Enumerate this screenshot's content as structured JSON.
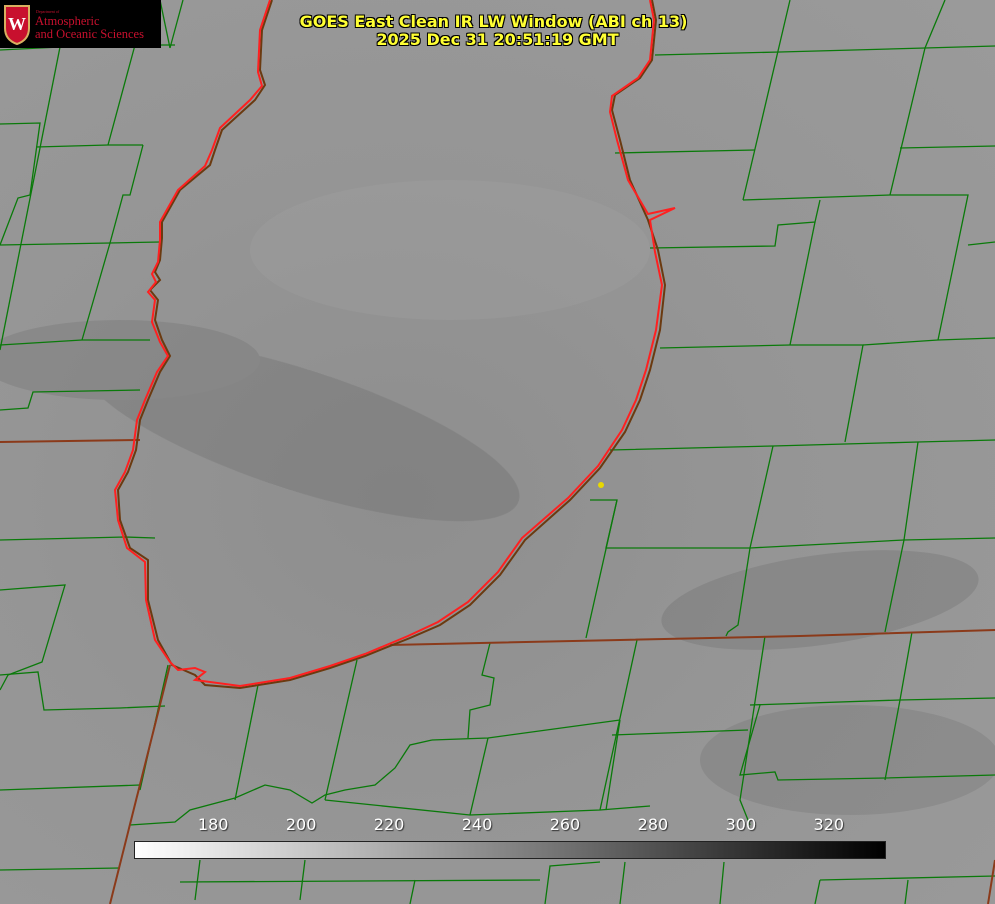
{
  "header": {
    "title_line1": "GOES East Clean IR LW Window (ABI ch 13)",
    "title_line2": "2025 Dec 31 20:51:19 GMT"
  },
  "logo": {
    "department": "Department of",
    "line1": "Atmospheric",
    "line2": "and Oceanic Sciences",
    "crest_letter": "W"
  },
  "colorbar": {
    "ticks": [
      "180",
      "200",
      "220",
      "240",
      "260",
      "280",
      "300",
      "320"
    ],
    "tick_values": [
      180,
      200,
      220,
      240,
      260,
      280,
      300,
      320
    ],
    "range": [
      162,
      333
    ],
    "gradient_start": "#ffffff",
    "gradient_end": "#000000"
  },
  "colors": {
    "county_lines": "#0a7a0a",
    "state_lines": "#8b3a1a",
    "shoreline": "#ff2020",
    "title_text": "#ffff33",
    "marker": "#e8d800",
    "logo_text": "#c8102e"
  }
}
